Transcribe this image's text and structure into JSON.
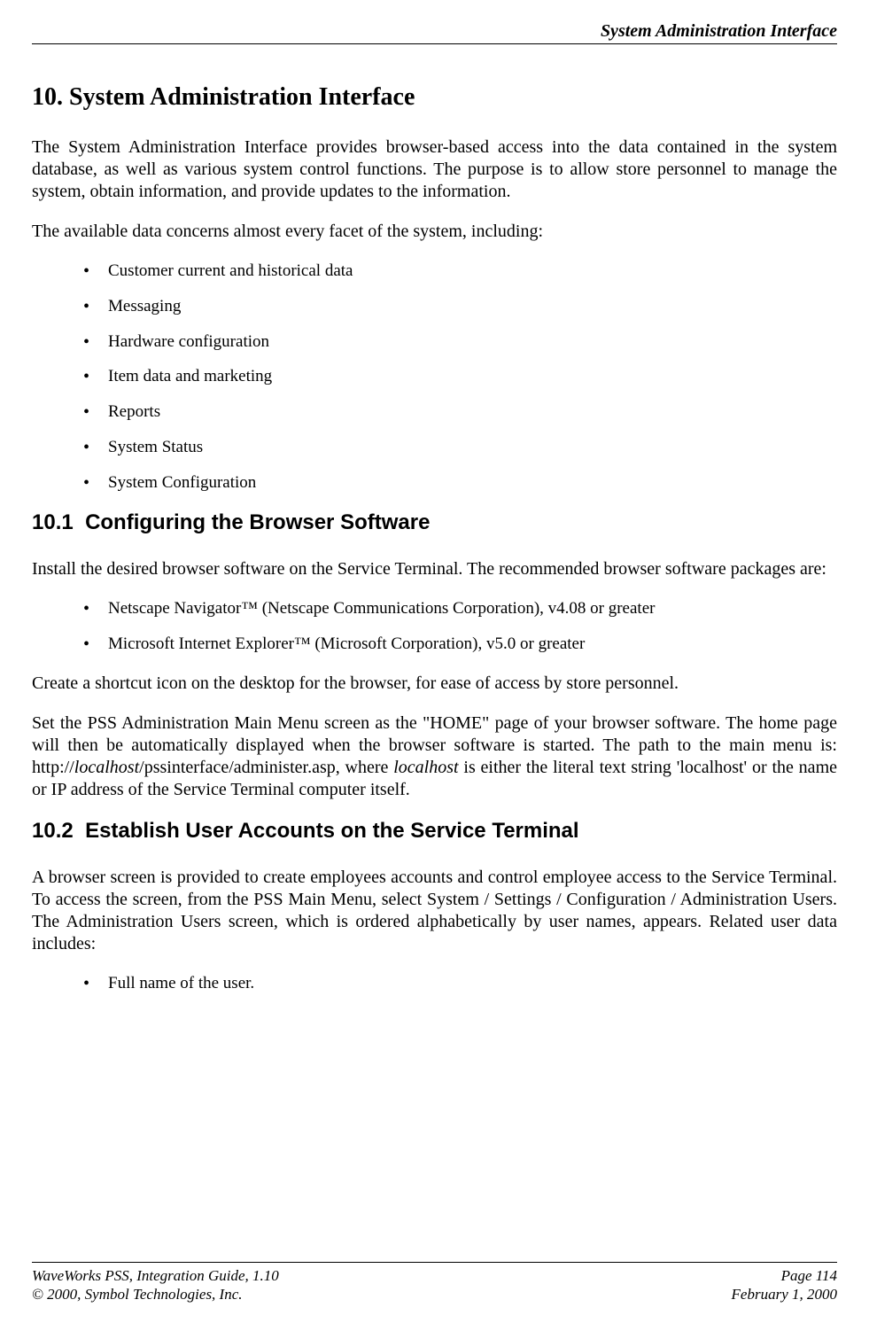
{
  "header": {
    "running_title": "System Administration Interface"
  },
  "section": {
    "number": "10.",
    "title": "System Administration Interface",
    "intro1": "The System Administration Interface provides browser-based access into the data contained in the system database, as well as various system control functions.  The purpose is to allow store personnel to manage the system, obtain information, and provide updates to the information.",
    "intro2": "The available data concerns almost every facet of the system, including:",
    "bullets1": [
      "Customer current and historical data",
      "Messaging",
      "Hardware configuration",
      "Item data and marketing",
      "Reports",
      "System Status",
      "System Configuration"
    ]
  },
  "sub1": {
    "number": "10.1",
    "title": "Configuring the Browser Software",
    "para1": "Install the desired browser software on the Service Terminal.  The recommended browser software packages are:",
    "bullets": [
      "Netscape Navigator™ (Netscape Communications Corporation), v4.08 or greater",
      "Microsoft Internet Explorer™ (Microsoft Corporation), v5.0 or greater"
    ],
    "para2": "Create a shortcut icon on the desktop for the browser, for ease of access by store personnel.",
    "para3_pre": "Set the PSS Administration Main Menu screen as the \"HOME\" page of your browser software. The home page will then be automatically displayed when the browser software is started.  The path to the main menu is:  http://",
    "para3_localhost1": "localhost",
    "para3_mid": "/pssinterface/administer.asp, where ",
    "para3_localhost2": "localhost",
    "para3_post": " is either the literal text string 'localhost' or the name or IP address of the Service Terminal computer itself."
  },
  "sub2": {
    "number": "10.2",
    "title": "Establish User Accounts on the Service Terminal",
    "para1": "A browser screen is provided to create employees accounts and control employee access to the Service Terminal.  To access the screen, from the PSS Main Menu, select System / Settings / Configuration / Administration Users.  The Administration Users screen, which is ordered alphabetically by user names, appears.  Related user data includes:",
    "bullets": [
      "Full name of the user."
    ]
  },
  "footer": {
    "left1": "WaveWorks PSS, Integration Guide, 1.10",
    "right1": "Page 114",
    "left2": "© 2000, Symbol Technologies, Inc.",
    "right2": "February 1, 2000"
  }
}
